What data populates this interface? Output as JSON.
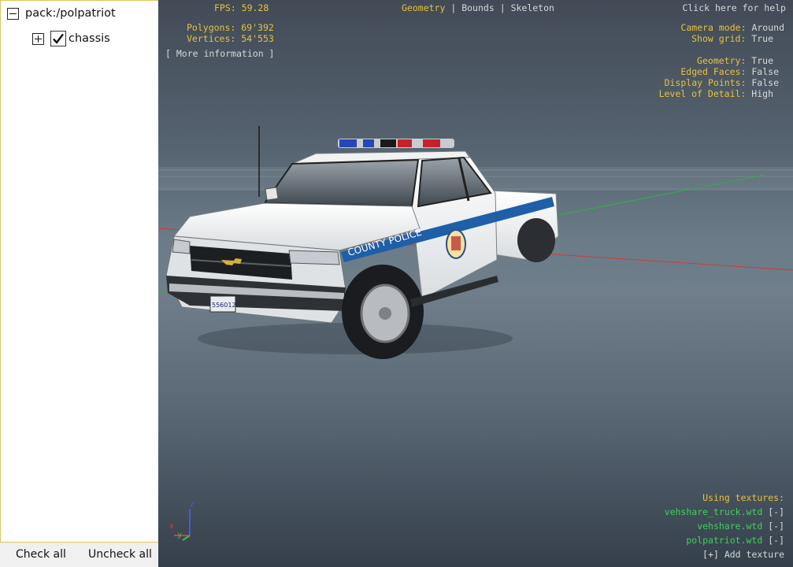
{
  "tree": {
    "root": {
      "label": "pack:/polpatriot",
      "expander": "minus"
    },
    "items": [
      {
        "label": "chassis",
        "expander": "plus",
        "checked": true
      }
    ]
  },
  "buttons": {
    "check_all": "Check all",
    "uncheck_all": "Uncheck all"
  },
  "hud": {
    "fps_label": "FPS:",
    "fps_value": "59.28",
    "polygons_label": "Polygons:",
    "polygons_value": "69'392",
    "vertices_label": "Vertices:",
    "vertices_value": "54'553",
    "more_info": "[ More information ]",
    "view_modes": [
      "Geometry",
      "Bounds",
      "Skeleton"
    ],
    "active_view_mode": "Geometry",
    "help": "Click here for help",
    "settings": [
      {
        "label": "Camera mode:",
        "value": "Around"
      },
      {
        "label": "Show grid:",
        "value": "True"
      }
    ],
    "render_settings": [
      {
        "label": "Geometry:",
        "value": "True"
      },
      {
        "label": "Edged Faces:",
        "value": "False"
      },
      {
        "label": "Display Points:",
        "value": "False"
      },
      {
        "label": "Level of Detail:",
        "value": "High"
      }
    ],
    "textures_title": "Using textures:",
    "textures": [
      {
        "name": "vehshare_truck.wtd",
        "action": "[-]"
      },
      {
        "name": "vehshare.wtd",
        "action": "[-]"
      },
      {
        "name": "polpatriot.wtd",
        "action": "[-]"
      }
    ],
    "add_texture": "[+] Add texture",
    "axis_labels": {
      "x": "x",
      "y": "y",
      "z": "z"
    }
  },
  "vehicle": {
    "livery_text": "COUNTY POLICE",
    "plate": "556012"
  },
  "colors": {
    "hud_label": "#e8c23c",
    "hud_value": "#d8d8d8",
    "texture_name": "#3fd05a",
    "axis_x": "#e03a3a",
    "axis_y": "#36c046",
    "axis_z": "#3f5cdf",
    "panel_border": "#d8c85a",
    "livery_stripe": "#1f5fa8"
  }
}
